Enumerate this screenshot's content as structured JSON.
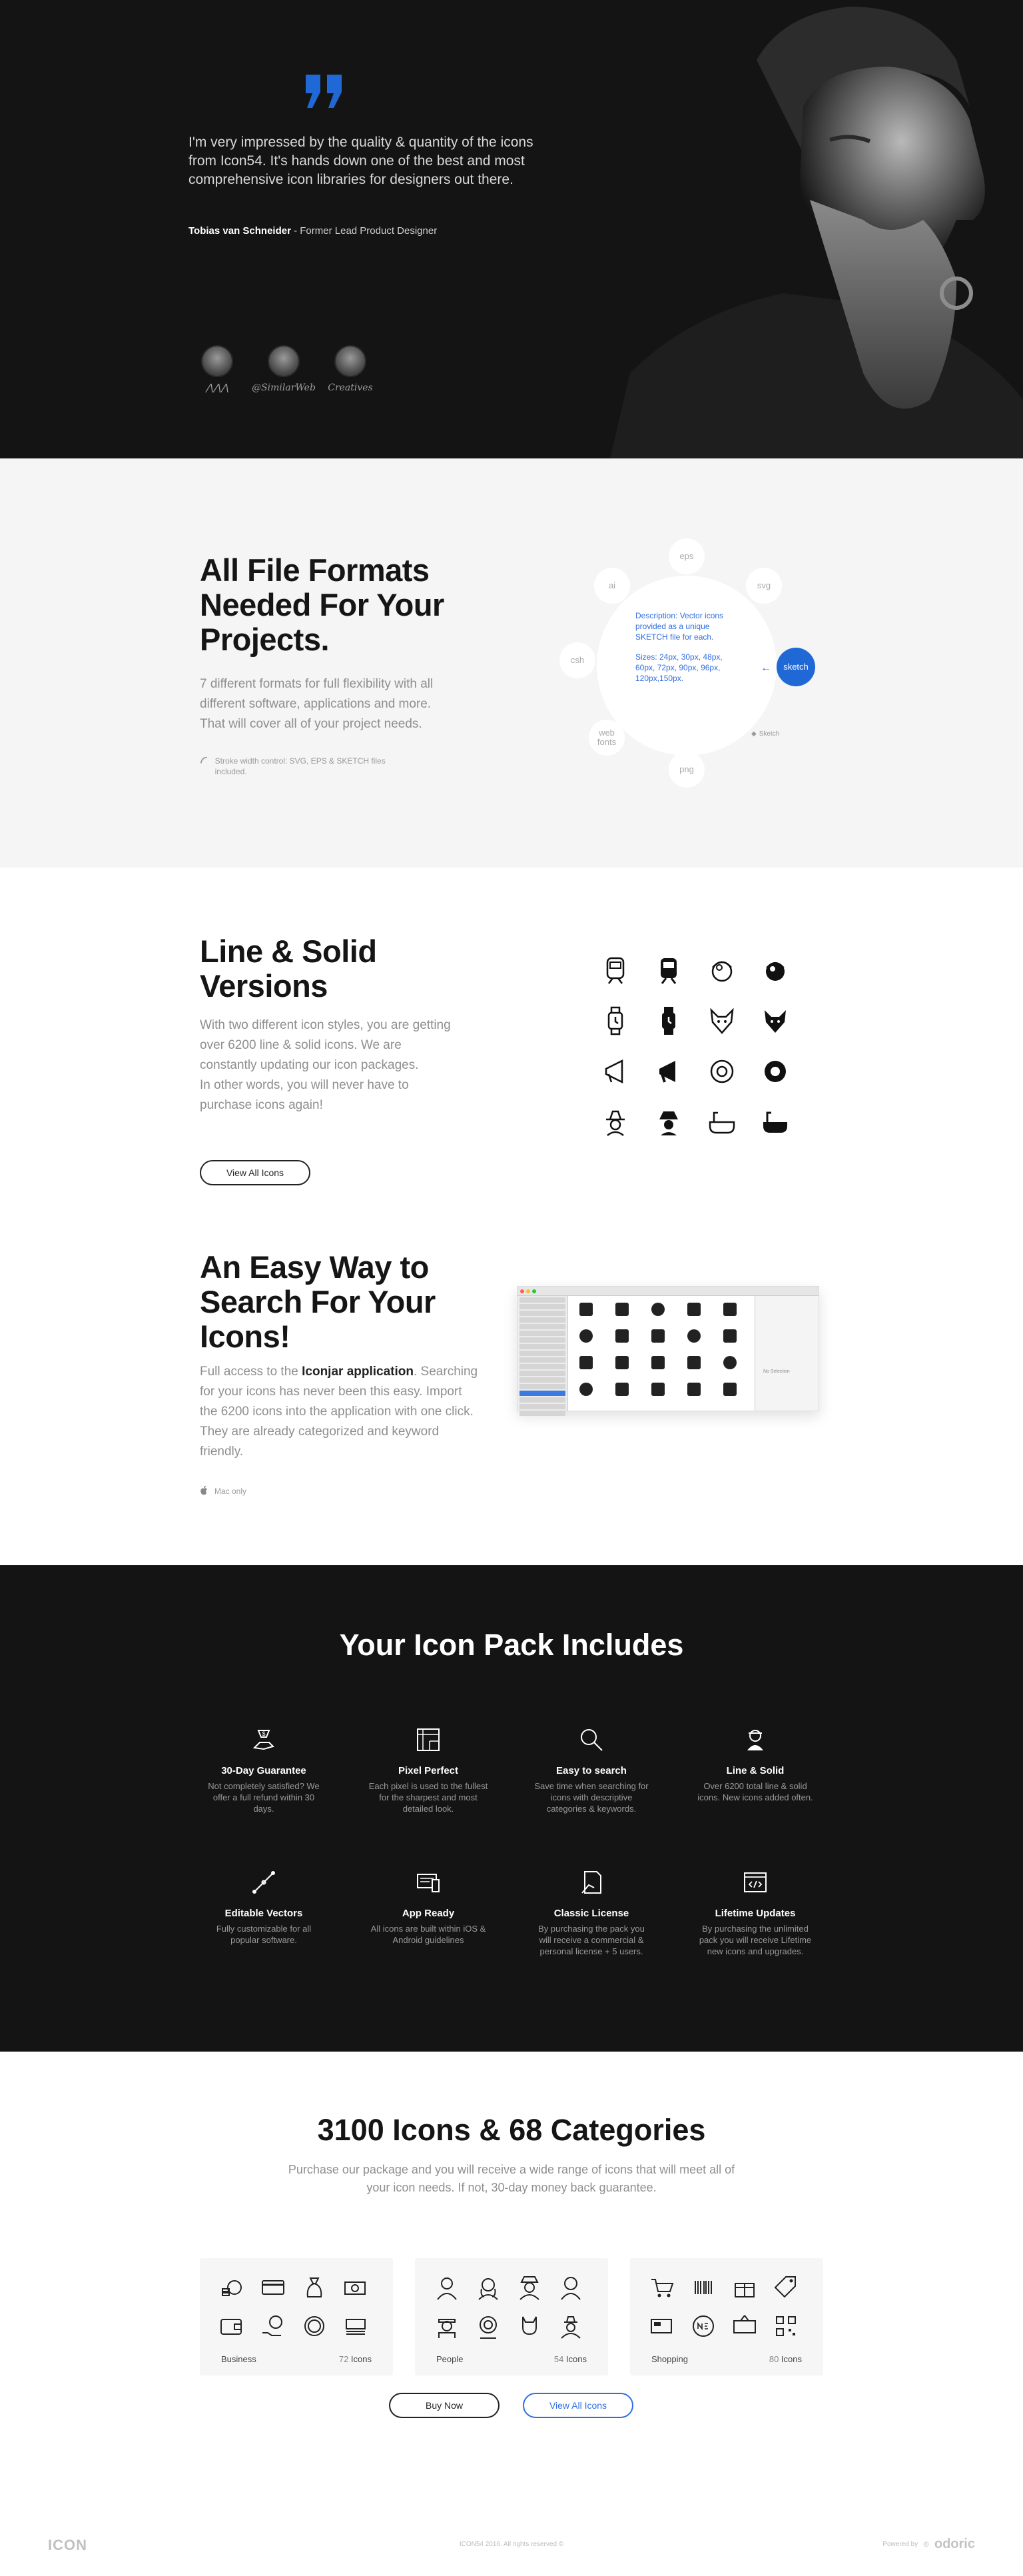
{
  "hero": {
    "quote": "I'm very impressed by the quality & quantity of the icons from Icon54. It's hands down one of the best and most comprehensive icon libraries for designers out there.",
    "author_name": "Tobias van Schneider",
    "author_role": " - Former Lead Product Designer",
    "logos": [
      "",
      "@SimilarWeb",
      "Creatives"
    ]
  },
  "formats": {
    "title": "All File Formats Needed For Your Projects.",
    "text": "7 different formats for full flexibility with all different software, applications and more. That will cover all of your project needs.",
    "note": "Stroke width control: SVG, EPS & SKETCH files included.",
    "description": "Description: Vector icons provided as a unique SKETCH file for each.",
    "sizes": "Sizes: 24px, 30px, 48px, 60px, 72px, 90px, 96px, 120px,150px.",
    "items": [
      "eps",
      "svg",
      "sketch",
      "png",
      "web fonts",
      "csh",
      "ai"
    ],
    "sketch_tag": "Sketch"
  },
  "line": {
    "title": "Line & Solid Versions",
    "text": "With two different icon styles, you are getting over 6200 line & solid icons. We are constantly updating our icon packages.\nIn other words, you will never have to purchase icons again!",
    "button": "View All Icons"
  },
  "search": {
    "title": "An Easy Way to Search For Your Icons!",
    "text_before": "Full access to the ",
    "text_bold": "Iconjar application",
    "text_after": ". Searching for your icons has never been this easy. Import the 6200 icons into the application with one click. They are already categorized and keyword friendly.",
    "note": "Mac only",
    "panel_text": "No Selection"
  },
  "features": {
    "title": "Your Icon Pack Includes",
    "items": [
      {
        "icon": "money-hand-icon",
        "title": "30-Day Guarantee",
        "text": "Not completely satisfied? We offer a full refund within 30 days."
      },
      {
        "icon": "pixel-grid-icon",
        "title": "Pixel Perfect",
        "text": "Each pixel is used to the fullest for the sharpest and most detailed look."
      },
      {
        "icon": "search-icon",
        "title": "Easy to search",
        "text": "Save time when searching for icons with descriptive categories & keywords."
      },
      {
        "icon": "avatar-icon",
        "title": "Line & Solid",
        "text": "Over 6200 total line & solid icons. New icons added often."
      },
      {
        "icon": "pen-tool-icon",
        "title": "Editable Vectors",
        "text": "Fully customizable for all popular software."
      },
      {
        "icon": "devices-icon",
        "title": "App Ready",
        "text": "All icons are built within iOS & Android guidelines"
      },
      {
        "icon": "license-icon",
        "title": "Classic License",
        "text": "By purchasing the pack you will receive a commercial & personal license + 5 users."
      },
      {
        "icon": "code-window-icon",
        "title": "Lifetime Updates",
        "text": "By purchasing the unlimited pack you will receive Lifetime new icons and upgrades."
      }
    ]
  },
  "categories": {
    "title": "3100 Icons & 68 Categories",
    "subtitle": "Purchase our package and you will receive a wide range of icons that will meet all of your icon needs. If not, 30-day money back guarantee.",
    "cards": [
      {
        "name": "Business",
        "count": "72",
        "unit": " Icons"
      },
      {
        "name": "People",
        "count": "54",
        "unit": " Icons"
      },
      {
        "name": "Shopping",
        "count": "80",
        "unit": " Icons"
      }
    ],
    "buy_button": "Buy Now",
    "view_button": "View All Icons"
  },
  "footer": {
    "logo": "ICON",
    "copyright": "ICON54 2016. All rights reserved ©",
    "powered": "Powered by",
    "brand": "odoric"
  },
  "colors": {
    "accent": "#1f68d6",
    "dark": "#141414",
    "light_bg": "#f5f5f5"
  }
}
